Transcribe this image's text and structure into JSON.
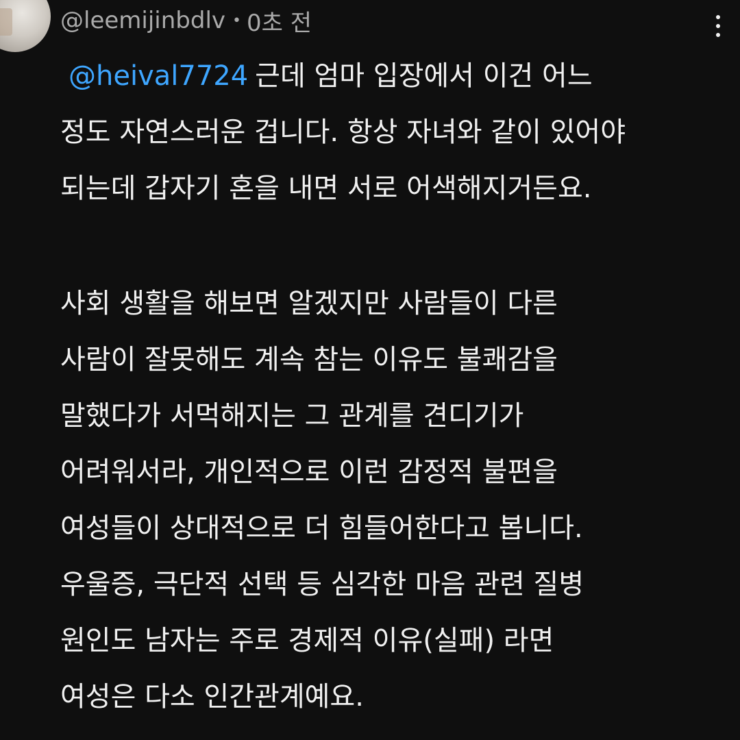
{
  "comment": {
    "author": "@leemijinbdlv",
    "separator": "•",
    "time": "0초 전",
    "mention": "@heival7724",
    "first_line_text": "근데 엄마 입장에서 이건 어느",
    "paragraph1_lines": [
      "정도 자연스러운 겁니다. 항상 자녀와 같이 있어야",
      "되는데 갑자기 혼을 내면 서로 어색해지거든요."
    ],
    "paragraph2_lines": [
      "사회 생활을 해보면 알겠지만 사람들이 다른",
      "사람이 잘못해도 계속 참는 이유도 불쾌감을",
      "말했다가 서먹해지는 그 관계를 견디기가",
      "어려워서라, 개인적으로 이런 감정적 불편을",
      "여성들이 상대적으로 더 힘들어한다고 봅니다.",
      "우울증, 극단적 선택 등 심각한 마음 관련 질병",
      "원인도 남자는 주로 경제적 이유(실패) 라면",
      "여성은 다소 인간관계예요."
    ]
  },
  "colors": {
    "background": "#0f0f0f",
    "text": "#f1f1f1",
    "meta": "#aaaaaa",
    "mention": "#3ea6ff"
  },
  "icons": {
    "menu": "more-vertical-icon"
  }
}
